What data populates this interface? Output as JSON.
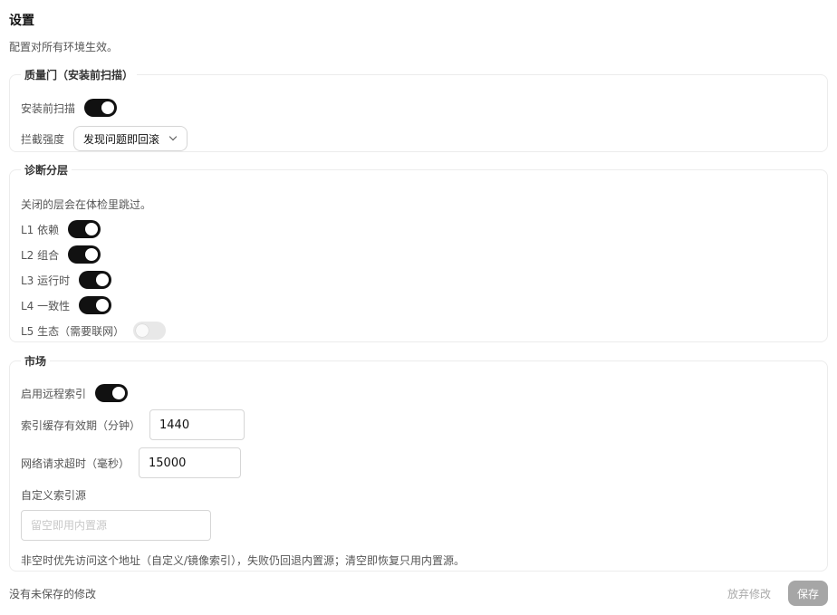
{
  "page": {
    "title": "设置",
    "description": "配置对所有环境生效。"
  },
  "quality_gate": {
    "legend": "质量门（安装前扫描）",
    "scan_label": "安装前扫描",
    "scan_enabled": true,
    "strength_label": "拦截强度",
    "strength_value": "发现问题即回滚"
  },
  "diagnostics": {
    "legend": "诊断分层",
    "description": "关闭的层会在体检里跳过。",
    "layers": [
      {
        "label": "L1 依赖",
        "enabled": true
      },
      {
        "label": "L2 组合",
        "enabled": true
      },
      {
        "label": "L3 运行时",
        "enabled": true
      },
      {
        "label": "L4 一致性",
        "enabled": true
      },
      {
        "label": "L5 生态（需要联网）",
        "enabled": false
      }
    ]
  },
  "market": {
    "legend": "市场",
    "remote_index_label": "启用远程索引",
    "remote_index_enabled": true,
    "cache_ttl_label": "索引缓存有效期（分钟）",
    "cache_ttl_value": "1440",
    "timeout_label": "网络请求超时（毫秒）",
    "timeout_value": "15000",
    "custom_source_label": "自定义索引源",
    "custom_source_placeholder": "留空即用内置源",
    "custom_source_value": "",
    "hint": "非空时优先访问这个地址（自定义/镜像索引），失败仍回退内置源；清空即恢复只用内置源。"
  },
  "footer": {
    "status": "没有未保存的修改",
    "discard_label": "放弃修改",
    "save_label": "保存"
  }
}
